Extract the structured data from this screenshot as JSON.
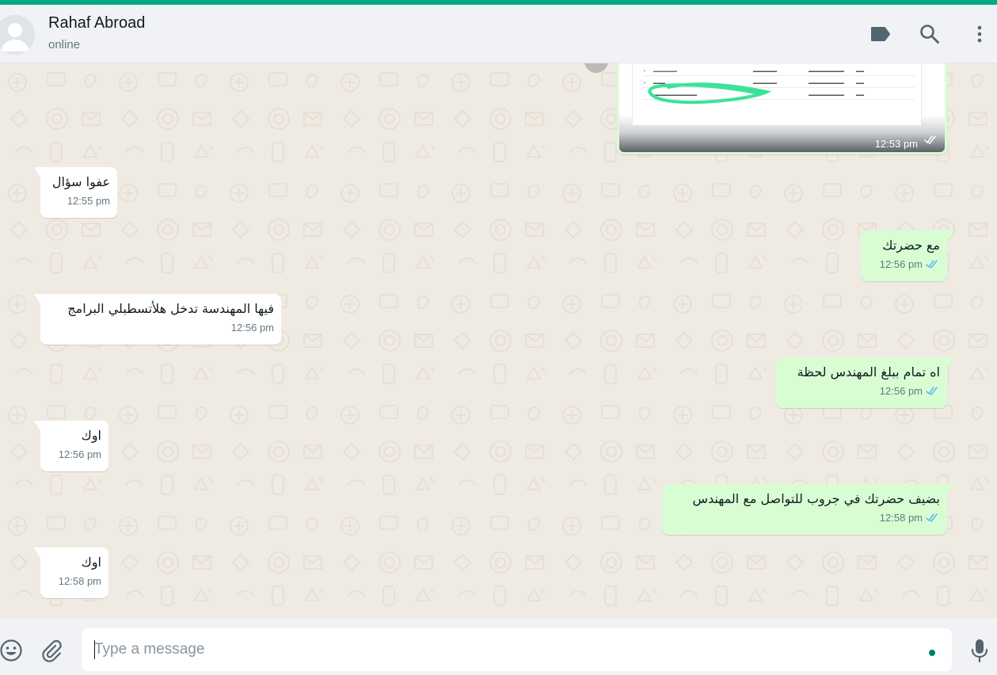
{
  "theme": {
    "accent": "#00a884",
    "header_bg": "#f0f2f5",
    "chat_bg": "#efeae2",
    "outgoing_bg": "#d9fdd3",
    "incoming_bg": "#ffffff",
    "tick_blue": "#53bdeb"
  },
  "header": {
    "contact_name": "Rahaf Abroad",
    "status": "online",
    "icons": [
      "label-icon",
      "search-icon",
      "more-options-icon"
    ]
  },
  "chat": {
    "image_message": {
      "time": "12:53 pm",
      "status": "read"
    },
    "messages": [
      {
        "direction": "in",
        "text": "عفوا سؤال",
        "time": "12:55 pm"
      },
      {
        "direction": "out",
        "text": "مع حضرتك",
        "time": "12:56 pm",
        "status": "read"
      },
      {
        "direction": "in",
        "text": "فيها المهندسة تدخل هلأتسطبلي البرامج",
        "time": "12:56 pm"
      },
      {
        "direction": "out",
        "text": "اه تمام ببلغ المهندس لحظة",
        "time": "12:56 pm",
        "status": "read"
      },
      {
        "direction": "in",
        "text": "اوك",
        "time": "12:56 pm"
      },
      {
        "direction": "out",
        "text": "بضيف حضرتك في جروب للتواصل مع المهندس",
        "time": "12:58 pm",
        "status": "read"
      },
      {
        "direction": "in",
        "text": "اوك",
        "time": "12:58 pm"
      }
    ]
  },
  "composer": {
    "placeholder": "Type a message",
    "icons": [
      "emoji-icon",
      "attach-icon",
      "microphone-icon"
    ]
  }
}
